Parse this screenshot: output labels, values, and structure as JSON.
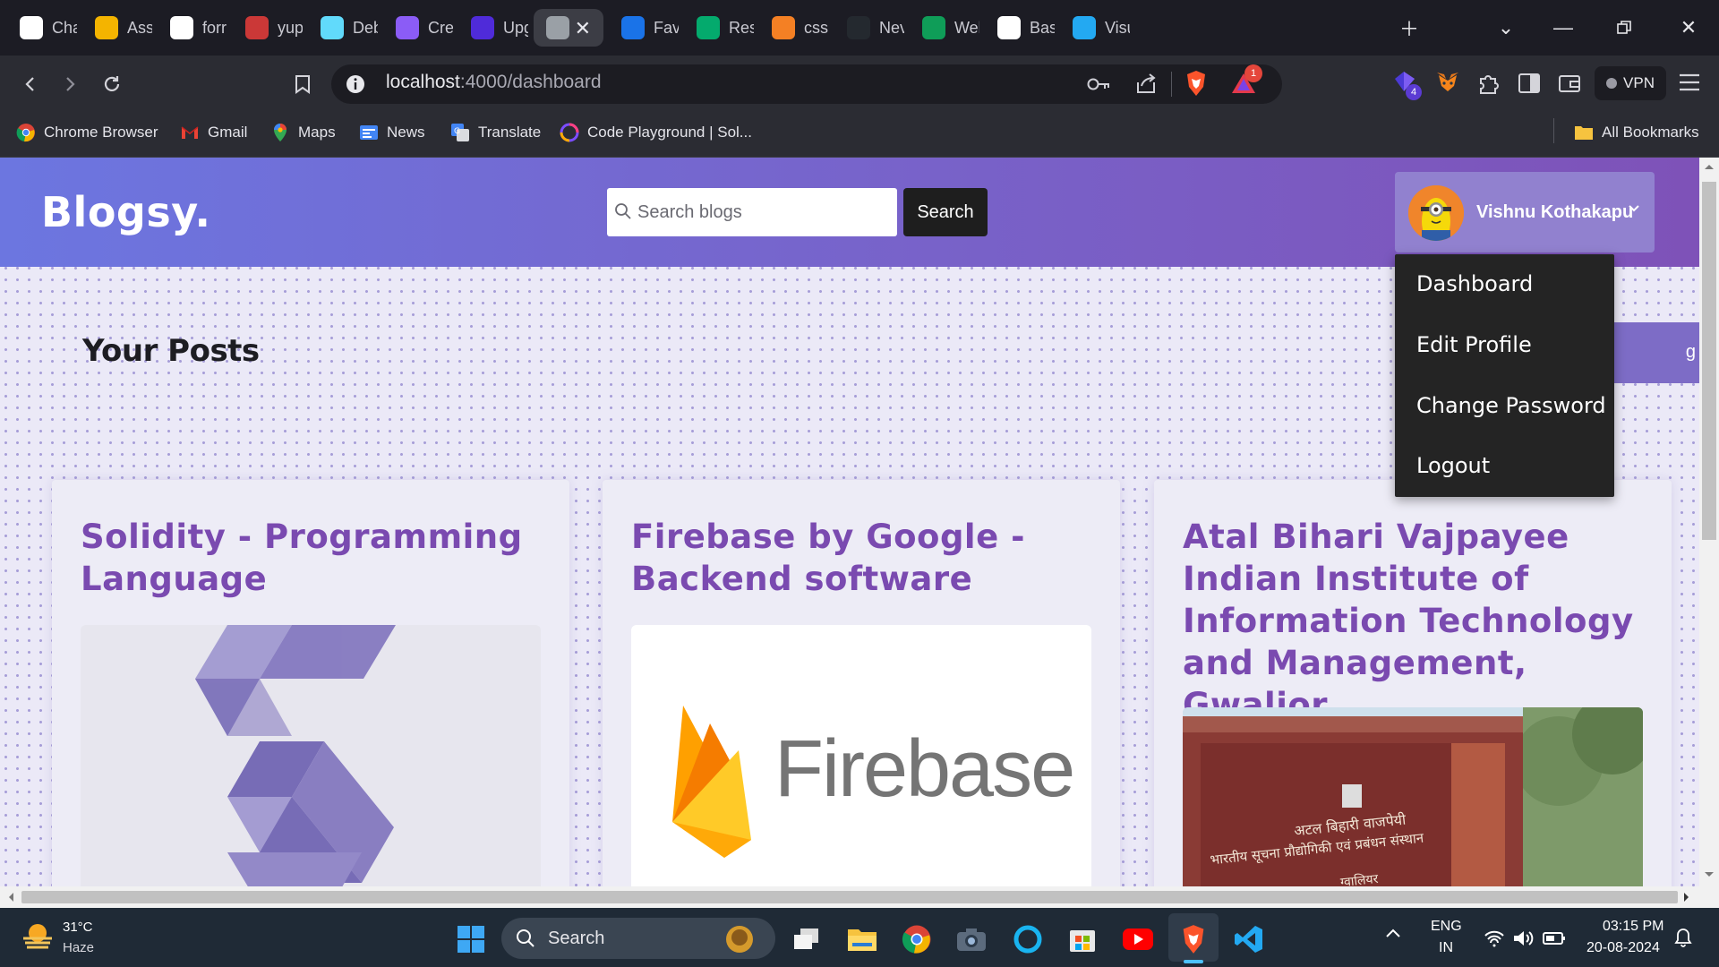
{
  "browser": {
    "tabs": [
      {
        "label": "Cha",
        "icon": "chatgpt-icon",
        "color": "#ffffff"
      },
      {
        "label": "Assi",
        "icon": "classroom-icon",
        "color": "#f4b400"
      },
      {
        "label": "forr",
        "icon": "google-icon",
        "color": "#ffffff"
      },
      {
        "label": "yup",
        "icon": "npm-icon",
        "color": "#cb3837"
      },
      {
        "label": "Deb",
        "icon": "react-icon",
        "color": "#61dafb"
      },
      {
        "label": "Cre",
        "icon": "shield-icon",
        "color": "#8b5cf6"
      },
      {
        "label": "Upg",
        "icon": "upgrad-icon",
        "color": "#4f2bd9"
      },
      {
        "label": "",
        "icon": "globe-icon",
        "color": "#9aa0a6",
        "active": true
      },
      {
        "label": "Favi",
        "icon": "favicon-icon",
        "color": "#1a73e8"
      },
      {
        "label": "Res",
        "icon": "w3schools-icon",
        "color": "#04aa6d"
      },
      {
        "label": "css",
        "icon": "stackoverflow-icon",
        "color": "#f48024"
      },
      {
        "label": "Nev",
        "icon": "github-dark-icon",
        "color": "#24292f"
      },
      {
        "label": "Wel",
        "icon": "drive-icon",
        "color": "#0f9d58"
      },
      {
        "label": "Basi",
        "icon": "github-icon",
        "color": "#ffffff"
      },
      {
        "label": "Visu",
        "icon": "vscode-icon",
        "color": "#23a9f2"
      }
    ],
    "url_host": "localhost",
    "url_path": ":4000/dashboard",
    "vpn_label": "VPN",
    "brave_badge": "1",
    "ext_badge": "4",
    "bookmarks": [
      {
        "label": "Chrome Browser",
        "icon": "chrome-icon"
      },
      {
        "label": "Gmail",
        "icon": "gmail-icon"
      },
      {
        "label": "Maps",
        "icon": "maps-icon"
      },
      {
        "label": "News",
        "icon": "news-icon"
      },
      {
        "label": "Translate",
        "icon": "translate-icon"
      },
      {
        "label": "Code Playground | Sol...",
        "icon": "codeplayground-icon"
      }
    ],
    "all_bookmarks": "All Bookmarks"
  },
  "site": {
    "brand": "Blogsy.",
    "search_placeholder": "Search blogs",
    "search_button": "Search",
    "user_name": "Vishnu Kothakapu",
    "page_title": "Your Posts",
    "create_button_partial": "g",
    "menu": [
      "Dashboard",
      "Edit Profile",
      "Change Password",
      "Logout"
    ],
    "posts": [
      {
        "title": "Solidity - Programming Language",
        "image": "solidity-logo"
      },
      {
        "title": "Firebase by Google - Backend software",
        "image": "firebase-logo",
        "image_text": "Firebase"
      },
      {
        "title": "Atal Bihari Vajpayee Indian Institute of Information Technology and Management, Gwalior",
        "image": "iiitm-gate-photo",
        "image_text": [
          "अटल बिहारी वाजपेयी",
          "भारतीय सूचना प्रौद्योगिकी एवं प्रबंधन संस्थान",
          "ग्वालियर"
        ]
      }
    ],
    "colors": {
      "header_start": "#6c76e0",
      "header_end": "#7e52b8",
      "title": "#7a4ab0",
      "dots": "#a79ed8"
    }
  },
  "taskbar": {
    "weather_temp": "31°C",
    "weather_desc": "Haze",
    "search_label": "Search",
    "lang1": "ENG",
    "lang2": "IN",
    "time": "03:15 PM",
    "date": "20-08-2024"
  }
}
